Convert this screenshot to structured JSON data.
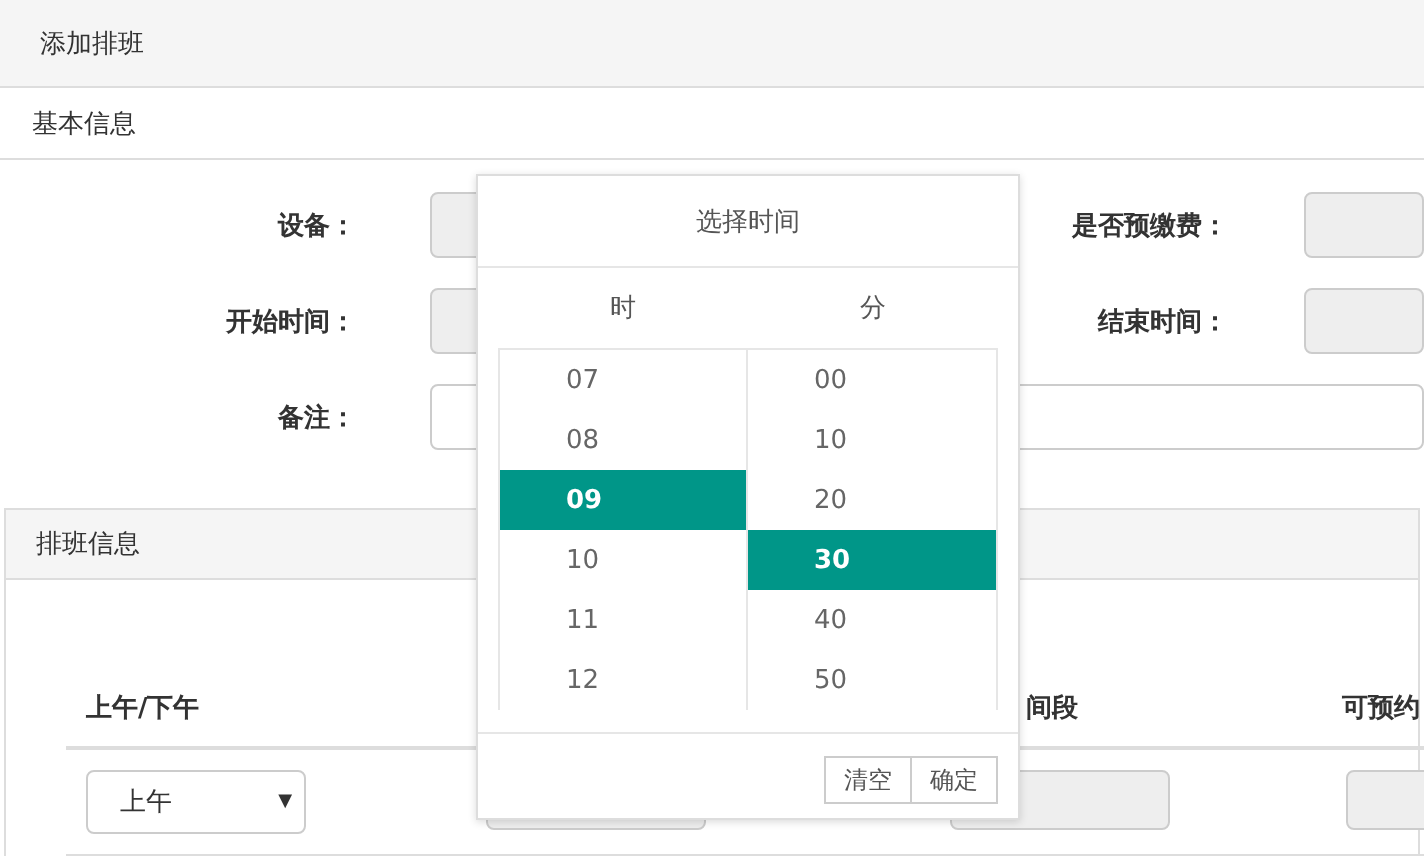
{
  "page_title": "添加排班",
  "basic_info": {
    "title": "基本信息",
    "rows": [
      {
        "left": {
          "label": "设备：",
          "kind": "disabled"
        },
        "right": {
          "label": "是否预缴费：",
          "kind": "disabled"
        }
      },
      {
        "left": {
          "label": "开始时间：",
          "kind": "disabled"
        },
        "right": {
          "label": "结束时间：",
          "kind": "disabled"
        }
      },
      {
        "left": {
          "label": "备注：",
          "kind": "wide"
        }
      }
    ]
  },
  "schedule": {
    "title": "排班信息",
    "columns": [
      "上午/下午",
      "间段",
      "可预约"
    ],
    "row": {
      "period": "上午",
      "caret": "▼"
    }
  },
  "picker": {
    "title": "选择时间",
    "hour_label": "时",
    "minute_label": "分",
    "hours": [
      {
        "value": "07",
        "selected": false
      },
      {
        "value": "08",
        "selected": false
      },
      {
        "value": "09",
        "selected": true
      },
      {
        "value": "10",
        "selected": false
      },
      {
        "value": "11",
        "selected": false
      },
      {
        "value": "12",
        "selected": false
      }
    ],
    "minutes": [
      {
        "value": "00",
        "selected": false
      },
      {
        "value": "10",
        "selected": false
      },
      {
        "value": "20",
        "selected": false
      },
      {
        "value": "30",
        "selected": true
      },
      {
        "value": "40",
        "selected": false
      },
      {
        "value": "50",
        "selected": false
      }
    ],
    "buttons": [
      "清空",
      "确定"
    ]
  }
}
